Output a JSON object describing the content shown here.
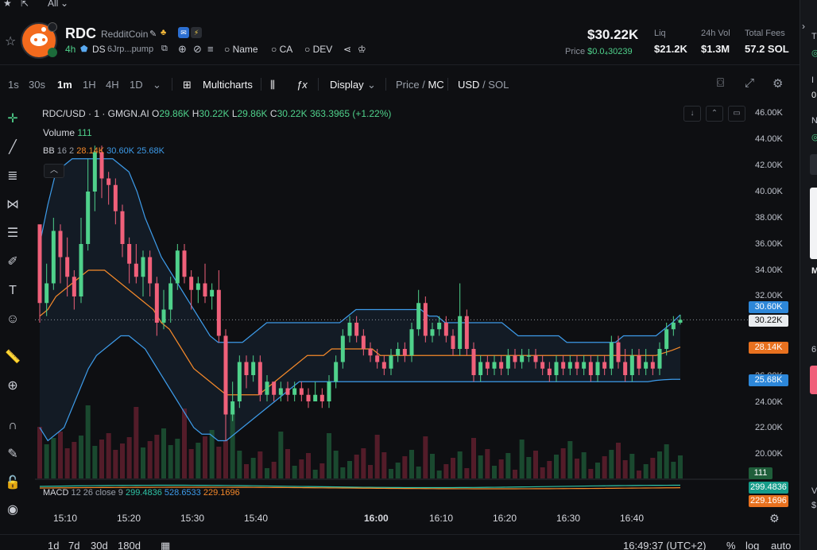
{
  "top": {
    "filter_label": "All"
  },
  "token": {
    "symbol": "RDC",
    "name": "RedditCoin",
    "age": "4h",
    "ds_label": "DS",
    "address": "6Jrp...pump",
    "links": {
      "name": "Name",
      "ca": "CA",
      "dev": "DEV"
    }
  },
  "stats": {
    "price_big": "$30.22K",
    "price_label": "Price",
    "price_value": "$0.0₄30239",
    "liq_label": "Liq",
    "liq_value": "$21.2K",
    "vol_label": "24h Vol",
    "vol_value": "$1.3M",
    "fees_label": "Total Fees",
    "fees_value": "57.2 SOL"
  },
  "toolbar": {
    "intervals": [
      "1s",
      "30s",
      "1m",
      "1H",
      "4H",
      "1D"
    ],
    "active_interval": "1m",
    "multicharts": "Multicharts",
    "display": "Display",
    "price_label": "Price",
    "mc_label": "MC",
    "usd_label": "USD",
    "sol_label": "SOL"
  },
  "legend": {
    "pair": "RDC/USD · 1 · GMGN.AI",
    "o_label": "O",
    "o": "29.86K",
    "h_label": "H",
    "h": "30.22K",
    "l_label": "L",
    "l": "29.86K",
    "c_label": "C",
    "c": "30.22K",
    "change": "363.3965 (+1.22%)",
    "volume_label": "Volume",
    "volume_value": "111",
    "bb_label": "BB",
    "bb_params": "16 2",
    "bb_mid": "28.14K",
    "bb_upper": "30.60K",
    "bb_lower": "25.68K",
    "macd_label": "MACD",
    "macd_params": "12 26 close 9",
    "macd_1": "299.4836",
    "macd_2": "528.6533",
    "macd_3": "229.1696"
  },
  "axis": {
    "price_ticks": [
      "46.00K",
      "44.00K",
      "42.00K",
      "40.00K",
      "38.00K",
      "36.00K",
      "34.00K",
      "32.00K",
      "30.00K",
      "28.00K",
      "26.00K",
      "24.00K",
      "22.00K",
      "20.00K"
    ],
    "time_ticks": [
      "15:10",
      "15:20",
      "15:30",
      "15:40",
      "16:00",
      "16:10",
      "16:20",
      "16:30",
      "16:40"
    ],
    "badges": {
      "bb_upper": "30.60K",
      "last_price": "30.22K",
      "bb_mid": "28.14K",
      "bb_lower": "25.68K",
      "volume": "111",
      "macd": "299.4836",
      "signal": "229.1696"
    }
  },
  "bottom": {
    "ranges": [
      "1d",
      "7d",
      "30d",
      "180d"
    ],
    "clock": "16:49:37 (UTC+2)",
    "percent": "%",
    "log": "log",
    "auto": "auto"
  },
  "colors": {
    "up": "#4fd18b",
    "down": "#f0607a",
    "bb_band": "#3d9be9",
    "bb_mid": "#f5892a",
    "background": "#0e0f12"
  },
  "chart_data": {
    "type": "candlestick",
    "ylim": [
      19000,
      46500
    ],
    "candles": [
      [
        37500,
        31500,
        32000,
        30000
      ],
      [
        31500,
        33000,
        34500,
        30500
      ],
      [
        33000,
        37000,
        38000,
        32500
      ],
      [
        37000,
        35000,
        37500,
        33000
      ],
      [
        35000,
        33500,
        36500,
        32000
      ],
      [
        33500,
        32000,
        34000,
        31000
      ],
      [
        32000,
        36000,
        38000,
        31500
      ],
      [
        36000,
        40000,
        42500,
        35500
      ],
      [
        40000,
        43000,
        43500,
        38500
      ],
      [
        43000,
        41000,
        43500,
        39500
      ],
      [
        41000,
        40500,
        41500,
        39000
      ],
      [
        40500,
        38500,
        41000,
        37500
      ],
      [
        38500,
        36000,
        39000,
        35000
      ],
      [
        36000,
        34500,
        36500,
        33000
      ],
      [
        34500,
        33500,
        36000,
        33000
      ],
      [
        33500,
        35000,
        35500,
        32000
      ],
      [
        35000,
        33000,
        35500,
        32000
      ],
      [
        33000,
        30000,
        33500,
        29000
      ],
      [
        30000,
        31000,
        32500,
        29500
      ],
      [
        31000,
        33000,
        33500,
        30000
      ],
      [
        33000,
        35500,
        36000,
        32500
      ],
      [
        35500,
        33500,
        36000,
        33000
      ],
      [
        33500,
        32500,
        34000,
        31000
      ],
      [
        32500,
        33000,
        33500,
        31500
      ],
      [
        33000,
        32000,
        34500,
        31500
      ],
      [
        32000,
        32500,
        33000,
        31000
      ],
      [
        32500,
        29000,
        34000,
        28500
      ],
      [
        29000,
        23000,
        29500,
        21000
      ],
      [
        23000,
        24000,
        25500,
        22500
      ],
      [
        24000,
        27000,
        27500,
        23500
      ],
      [
        27000,
        26000,
        27500,
        25000
      ],
      [
        26000,
        27000,
        27500,
        25500
      ],
      [
        27000,
        24500,
        27500,
        24000
      ],
      [
        24500,
        25500,
        26000,
        24000
      ],
      [
        25500,
        24500,
        25500,
        24000
      ],
      [
        24500,
        25000,
        25500,
        24000
      ],
      [
        25000,
        24500,
        25500,
        24000
      ],
      [
        24500,
        25000,
        25500,
        24000
      ],
      [
        25000,
        24500,
        25500,
        24000
      ],
      [
        24500,
        24000,
        25000,
        23500
      ],
      [
        24000,
        24500,
        25500,
        24000
      ],
      [
        24500,
        24000,
        25000,
        23500
      ],
      [
        24000,
        25500,
        26000,
        23500
      ],
      [
        25500,
        27000,
        27500,
        25000
      ],
      [
        27000,
        29000,
        29500,
        26500
      ],
      [
        29000,
        30000,
        30500,
        28500
      ],
      [
        30000,
        29000,
        30500,
        28500
      ],
      [
        29000,
        28000,
        29500,
        27500
      ],
      [
        28000,
        27500,
        28500,
        27000
      ],
      [
        27500,
        27000,
        28000,
        26500
      ],
      [
        27000,
        26500,
        27500,
        26000
      ],
      [
        26500,
        27500,
        28000,
        26000
      ],
      [
        27500,
        28000,
        28500,
        27000
      ],
      [
        28000,
        27500,
        28500,
        27000
      ],
      [
        27500,
        29500,
        30000,
        27000
      ],
      [
        29500,
        31500,
        32500,
        29000
      ],
      [
        31500,
        29000,
        32000,
        28500
      ],
      [
        29000,
        29500,
        30000,
        28500
      ],
      [
        29500,
        30000,
        30500,
        29000
      ],
      [
        30000,
        29000,
        30500,
        28500
      ],
      [
        29000,
        28000,
        29500,
        27500
      ],
      [
        28000,
        30500,
        33000,
        27500
      ],
      [
        30500,
        28000,
        31000,
        27500
      ],
      [
        28000,
        26000,
        28500,
        25500
      ],
      [
        26000,
        27000,
        27500,
        25500
      ],
      [
        27000,
        26500,
        27500,
        26000
      ],
      [
        26500,
        27000,
        27500,
        26000
      ],
      [
        27000,
        26500,
        27500,
        26000
      ],
      [
        26500,
        27500,
        28000,
        26000
      ],
      [
        27500,
        27000,
        28000,
        26500
      ],
      [
        27000,
        27500,
        28000,
        26500
      ],
      [
        27500,
        27500,
        28000,
        27000
      ],
      [
        27500,
        27000,
        28000,
        26500
      ],
      [
        27000,
        26500,
        27500,
        26000
      ],
      [
        26500,
        26000,
        27000,
        25500
      ],
      [
        26000,
        27000,
        27500,
        25500
      ],
      [
        27000,
        26500,
        27500,
        26000
      ],
      [
        26500,
        27000,
        27500,
        26000
      ],
      [
        27000,
        26500,
        27500,
        26000
      ],
      [
        26500,
        27000,
        27500,
        26000
      ],
      [
        27000,
        26000,
        27500,
        25500
      ],
      [
        26000,
        27000,
        27500,
        25500
      ],
      [
        27000,
        26500,
        27500,
        26000
      ],
      [
        26500,
        28500,
        29000,
        26000
      ],
      [
        28500,
        27000,
        29000,
        26500
      ],
      [
        27000,
        26000,
        28000,
        25500
      ],
      [
        26000,
        27500,
        28000,
        25500
      ],
      [
        27500,
        26500,
        28000,
        26000
      ],
      [
        26500,
        27000,
        28000,
        26000
      ],
      [
        27000,
        26500,
        27500,
        26000
      ],
      [
        26500,
        28000,
        28500,
        26000
      ],
      [
        28000,
        29500,
        30000,
        27500
      ],
      [
        29500,
        30000,
        30500,
        29000
      ],
      [
        30000,
        30220,
        30600,
        29860
      ]
    ],
    "bb_upper": [
      36000,
      39000,
      41500,
      42000,
      42500,
      42500,
      42500,
      42500,
      42500,
      42500,
      42000,
      41500,
      40000,
      38000,
      36500,
      35000,
      34000,
      33000,
      32000,
      31000,
      30000,
      29000,
      28500,
      28500,
      28500,
      28500,
      29000,
      29500,
      30000,
      30000,
      30000,
      30000,
      30000,
      30000,
      30000,
      30000,
      30000,
      30000,
      30500,
      31000,
      31000,
      31000,
      31000,
      31000,
      31000,
      31000,
      31000,
      31000,
      30500,
      30500,
      30000,
      30000,
      30000,
      30000,
      30000,
      30000,
      30000,
      30000,
      29500,
      29000,
      29000,
      29000,
      29000,
      29000,
      29000,
      28500,
      28500,
      28500,
      28500,
      28500,
      28500,
      28500,
      29000,
      29000,
      29000,
      29000,
      29000,
      29500,
      30000,
      30600
    ],
    "bb_mid": [
      30500,
      31000,
      32000,
      32500,
      33000,
      33500,
      34000,
      34000,
      34000,
      33500,
      33000,
      32500,
      32000,
      31500,
      31000,
      30000,
      29500,
      28500,
      27500,
      26500,
      26000,
      25500,
      25000,
      24500,
      24500,
      24500,
      24500,
      24500,
      25000,
      25500,
      26000,
      26500,
      27000,
      27500,
      27500,
      27500,
      28000,
      28000,
      28000,
      28000,
      28000,
      28000,
      27500,
      27500,
      27500,
      27500,
      27500,
      27500,
      27500,
      27500,
      27500,
      27500,
      27500,
      27500,
      27500,
      27500,
      27500,
      27500,
      27500,
      27500,
      27500,
      27500,
      27500,
      27500,
      27500,
      27500,
      27500,
      27500,
      27500,
      27500,
      27500,
      27500,
      27500,
      27500,
      27500,
      27500,
      27500,
      27700,
      27900,
      28140
    ],
    "bb_lower": [
      22000,
      21000,
      21500,
      22000,
      23500,
      25000,
      26500,
      27500,
      28000,
      28500,
      29000,
      29000,
      28500,
      28000,
      27000,
      26000,
      25000,
      24000,
      23000,
      22000,
      21500,
      21500,
      21000,
      21000,
      21500,
      22000,
      22500,
      23000,
      23500,
      24000,
      24500,
      25000,
      25500,
      25500,
      25500,
      25500,
      25500,
      25500,
      25500,
      25500,
      25500,
      25500,
      25500,
      25500,
      25500,
      25500,
      25500,
      25500,
      25500,
      25500,
      25500,
      25500,
      25500,
      25500,
      25500,
      25500,
      25500,
      25500,
      25500,
      25500,
      25500,
      25500,
      25500,
      25500,
      25500,
      25500,
      25500,
      25500,
      25500,
      25500,
      25500,
      25500,
      25500,
      25500,
      25500,
      25500,
      25600,
      25650,
      25680,
      25680
    ]
  }
}
